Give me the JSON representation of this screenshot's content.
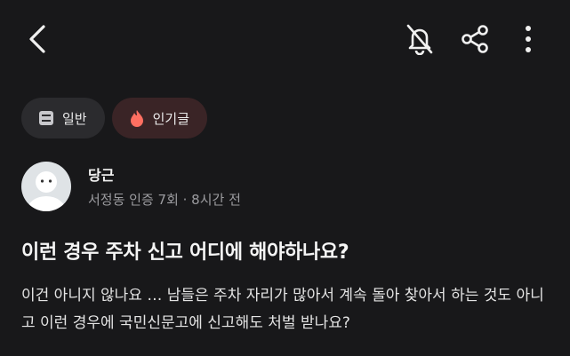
{
  "toolbar": {
    "back_icon": "chevron-left-icon",
    "mute_icon": "bell-off-icon",
    "share_icon": "share-icon",
    "more_icon": "more-vertical-icon"
  },
  "chips": [
    {
      "label": "일반",
      "icon": "document-icon"
    },
    {
      "label": "인기글",
      "icon": "fire-icon",
      "color": "#ff6f61"
    }
  ],
  "author": {
    "name": "당근",
    "meta": "서정동 인증 7회 · 8시간 전"
  },
  "post": {
    "title": "이런 경우 주차 신고 어디에 해야하나요?",
    "body": "이건 아니지 않나요 … 남들은 주차 자리가 많아서 계속 돌아 찾아서 하는 것도 아니고 이런 경우에 국민신문고에 신고해도 처벌 받나요?"
  }
}
